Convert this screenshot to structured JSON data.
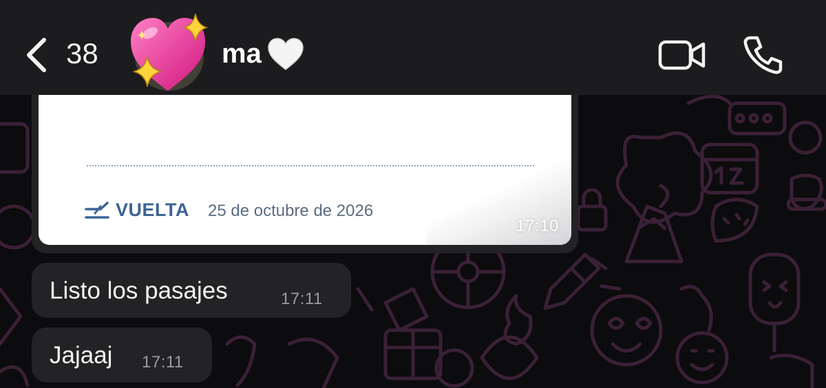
{
  "header": {
    "back_count": "38",
    "contact_name": "ma",
    "icons": {
      "back": "chevron-left-icon",
      "avatar": "sparkling-heart-emoji",
      "name_emoji": "white-heart-emoji",
      "video": "video-camera-icon",
      "phone": "phone-icon"
    }
  },
  "messages": [
    {
      "type": "ticket-image",
      "ticket": {
        "label": "VUELTA",
        "date": "25 de octubre de 2026",
        "icon": "plane-landing-icon"
      },
      "time": "17:10"
    },
    {
      "type": "text",
      "text": "Listo los pasajes",
      "time": "17:11"
    },
    {
      "type": "text",
      "text": "Jajaaj",
      "time": "17:11"
    }
  ],
  "colors": {
    "header_bg": "#1c1c1e",
    "bubble_bg": "#232325",
    "wallpaper_bg": "#0c0b0d",
    "doodle": "#3a2036",
    "ticket_accent": "#3c6496"
  }
}
